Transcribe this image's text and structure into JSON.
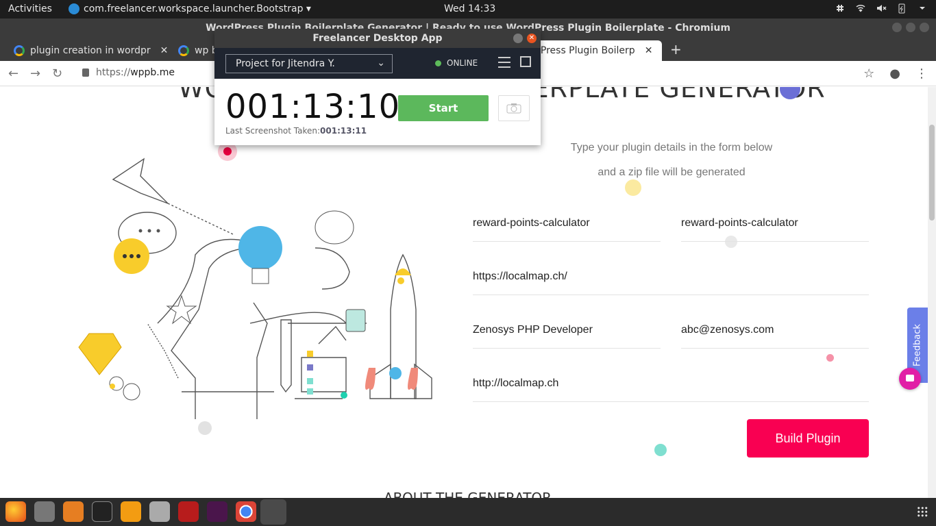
{
  "topbar": {
    "activities": "Activities",
    "app_name": "com.freelancer.workspace.launcher.Bootstrap ▾",
    "clock": "Wed 14:33"
  },
  "browser": {
    "window_title": "WordPress Plugin Boilerplate Generator | Ready to use WordPress Plugin Boilerplate - Chromium",
    "tabs": [
      {
        "label": "plugin creation in wordpr"
      },
      {
        "label": "wp b"
      },
      {
        "label": "dPress Plugin Boilerp"
      }
    ],
    "url_scheme": "https://",
    "url_host": "wppb.me"
  },
  "page": {
    "hero_title": "WORDPRESS PLUGIN BOILERPLATE GENERATOR",
    "subtitle_line1": "Type your plugin details in the form below",
    "subtitle_line2": "and a zip file will be generated",
    "fields": {
      "plugin_name": "reward-points-calculator",
      "plugin_slug": "reward-points-calculator",
      "plugin_uri": "https://localmap.ch/",
      "author_name": "Zenosys PHP Developer",
      "author_email": "abc@zenosys.com",
      "author_uri": "http://localmap.ch"
    },
    "build_button": "Build Plugin",
    "about_heading": "ABOUT THE GENERATOR",
    "feedback": "Feedback"
  },
  "freelancer_app": {
    "title": "Freelancer Desktop App",
    "project": "Project for Jitendra Y.",
    "status": "ONLINE",
    "timer": "001:13:10",
    "start_button": "Start",
    "last_screenshot_label": "Last Screenshot Taken:",
    "last_screenshot_value": "001:13:11"
  },
  "colors": {
    "build_button": "#f90052",
    "start_button": "#5cb85c",
    "online_led": "#5dbb5a",
    "feedback_tab": "#6b7fe8"
  }
}
